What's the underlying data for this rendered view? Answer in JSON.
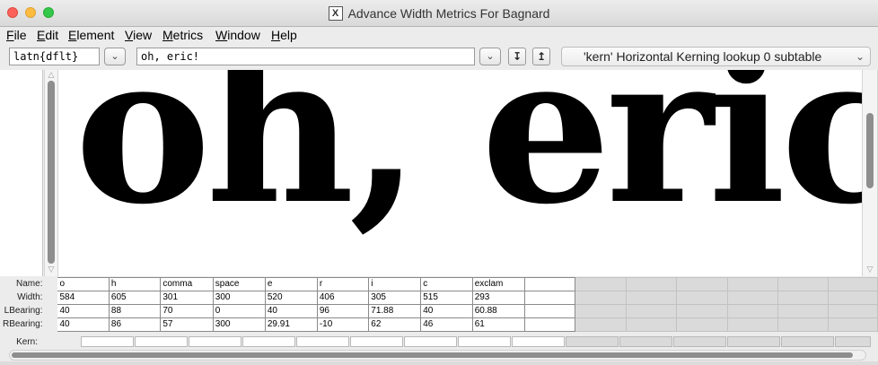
{
  "window": {
    "title": "Advance Width Metrics For Bagnard",
    "title_icon": "X"
  },
  "menu": [
    "File",
    "Edit",
    "Element",
    "View",
    "Metrics",
    "Window",
    "Help"
  ],
  "toolbar": {
    "script_value": "latn{dflt}",
    "text_value": "oh, eric!",
    "lookup_value": "'kern' Horizontal Kerning lookup 0 subtable"
  },
  "preview_text": "oh, eric!",
  "row_labels": {
    "name": "Name:",
    "width": "Width:",
    "lbearing": "LBearing:",
    "rbearing": "RBearing:",
    "kern": "Kern:"
  },
  "glyphs": [
    {
      "name": "o",
      "width": "584",
      "lbearing": "40",
      "rbearing": "40"
    },
    {
      "name": "h",
      "width": "605",
      "lbearing": "88",
      "rbearing": "86"
    },
    {
      "name": "comma",
      "width": "301",
      "lbearing": "70",
      "rbearing": "57"
    },
    {
      "name": "space",
      "width": "300",
      "lbearing": "0",
      "rbearing": "300"
    },
    {
      "name": "e",
      "width": "520",
      "lbearing": "40",
      "rbearing": "29.91"
    },
    {
      "name": "r",
      "width": "406",
      "lbearing": "96",
      "rbearing": "-10"
    },
    {
      "name": "i",
      "width": "305",
      "lbearing": "71.88",
      "rbearing": "62"
    },
    {
      "name": "c",
      "width": "515",
      "lbearing": "40",
      "rbearing": "46"
    },
    {
      "name": "exclam",
      "width": "293",
      "lbearing": "60.88",
      "rbearing": "61"
    }
  ],
  "colors": {
    "close": "#fc605b",
    "minimize": "#fdbc40",
    "zoom": "#34c84a"
  }
}
